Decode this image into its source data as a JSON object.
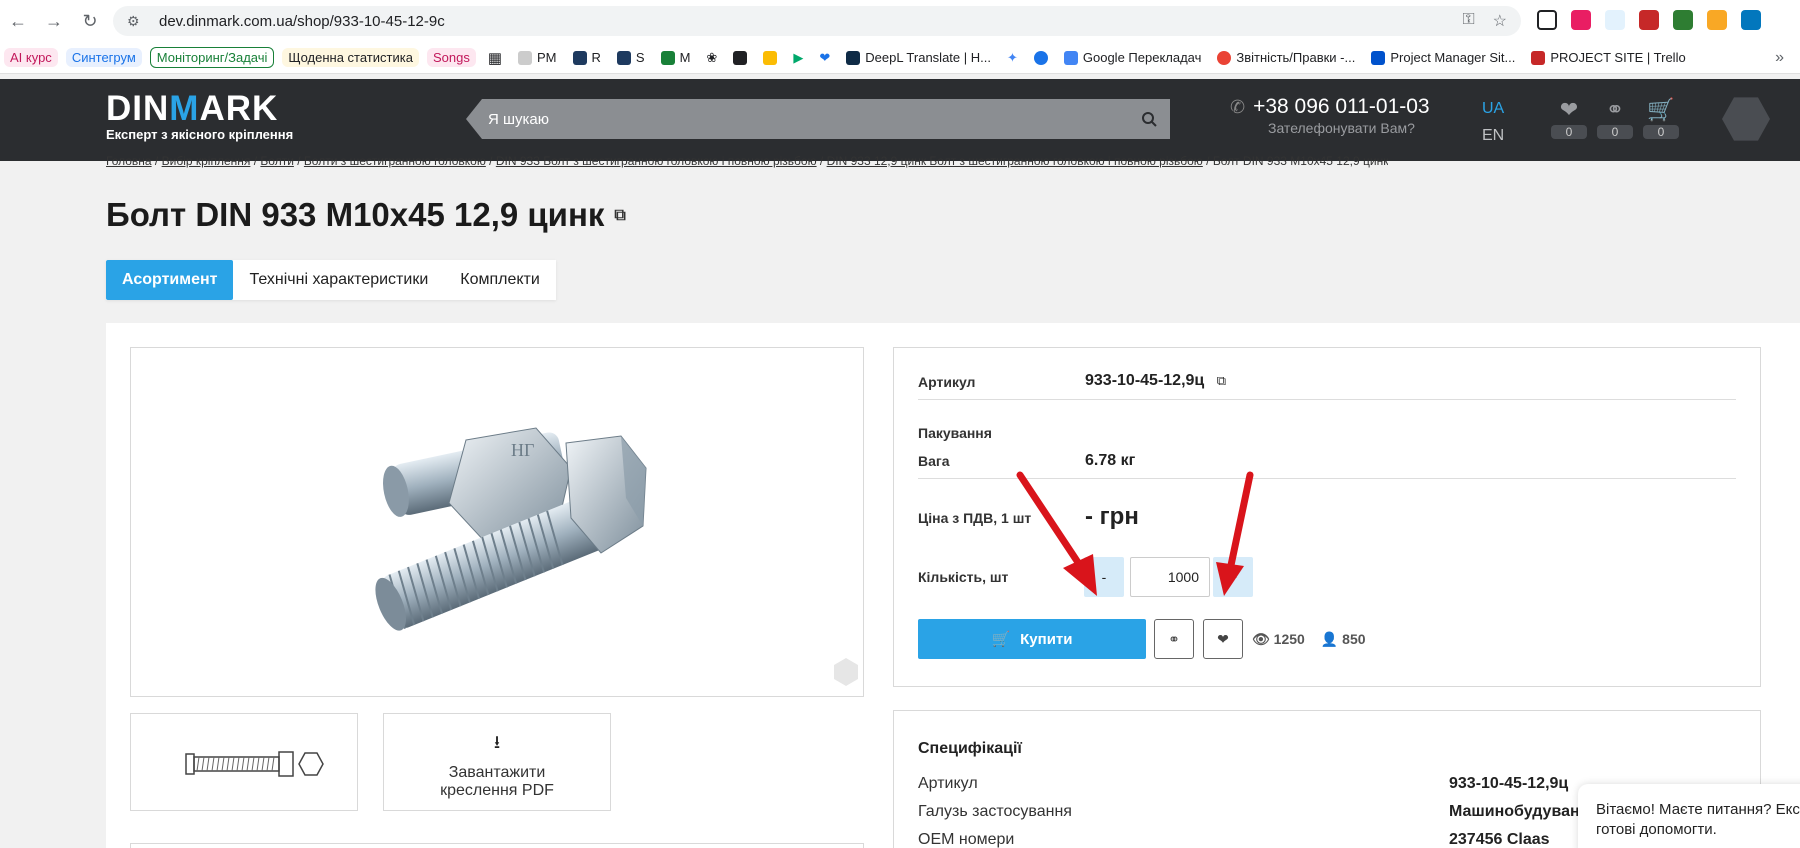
{
  "browser": {
    "url": "dev.dinmark.com.ua/shop/933-10-45-12-9c",
    "bookmarks": [
      {
        "label": "AI курс",
        "color": "#c2185b"
      },
      {
        "label": "Синтегрум",
        "color": "#1a73e8"
      },
      {
        "label": "Моніторинг/Задачі",
        "color": "#188038"
      },
      {
        "label": "Щоденна статистика",
        "color": "#202124"
      },
      {
        "label": "Songs",
        "color": "#c2185b"
      },
      {
        "label": "PM",
        "color": "#202124"
      },
      {
        "label": "R",
        "color": "#202124"
      },
      {
        "label": "S",
        "color": "#202124"
      },
      {
        "label": "M",
        "color": "#202124"
      },
      {
        "label": "DeepL Translate | H...",
        "color": "#202124"
      },
      {
        "label": "Google Перекладач",
        "color": "#202124"
      },
      {
        "label": "Звітність/Правки -...",
        "color": "#202124"
      },
      {
        "label": "Project Manager Sit...",
        "color": "#202124"
      },
      {
        "label": "PROJECT SITE | Trello",
        "color": "#202124"
      }
    ]
  },
  "header": {
    "logo_a": "DIN",
    "logo_m": "M",
    "logo_b": "ARK",
    "tagline": "Експерт з якісного кріплення",
    "search_placeholder": "Я шукаю",
    "phone": "+38 096 011-01-03",
    "callback": "Зателефонувати Вам?",
    "lang_ua": "UA",
    "lang_en": "EN",
    "wishlist_count": "0",
    "compare_count": "0",
    "cart_count": "0"
  },
  "breadcrumb": [
    "Головна",
    "Вибір кріплення",
    "Болти",
    "Болти з шестигранною головкою",
    "DIN 933 Болт з шестигранною головкою і повною різьбою",
    "DIN 933 12,9 цинк Болт з шестигранною головкою і повною різьбою",
    "Болт DIN 933 M10x45 12,9 цинк"
  ],
  "product": {
    "title": "Болт DIN 933 M10x45 12,9 цинк",
    "tabs": [
      "Асортимент",
      "Технічні характеристики",
      "Комплекти"
    ],
    "article_label": "Артикул",
    "article_value": "933-10-45-12,9ц",
    "packing_label": "Пакування",
    "weight_label": "Вага",
    "weight_value": "6.78 кг",
    "price_label": "Ціна з ПДВ, 1 шт",
    "price_value": "- грн",
    "qty_label": "Кількість, шт",
    "qty_minus": "-",
    "qty_plus": "+",
    "qty_value": "1000",
    "buy_label": "Купити",
    "views": "1250",
    "buyers": "850",
    "pdf_line1": "Завантажити",
    "pdf_line2": "креслення PDF",
    "head_mark": "НГ"
  },
  "specs": {
    "title": "Специфікації",
    "rows": [
      {
        "label": "Артикул",
        "value": "933-10-45-12,9ц"
      },
      {
        "label": "Галузь застосування",
        "value": "Машинобудуван"
      },
      {
        "label": "OEM номери",
        "value": "237456 Claas"
      }
    ]
  },
  "chat": {
    "line1": "Вітаємо! Маєте питання? Екс",
    "line2": "готові допомогти."
  },
  "colors": {
    "accent": "#2aa3e6",
    "header_bg": "#2b2d30",
    "annotation_arrow": "#d9141b"
  }
}
